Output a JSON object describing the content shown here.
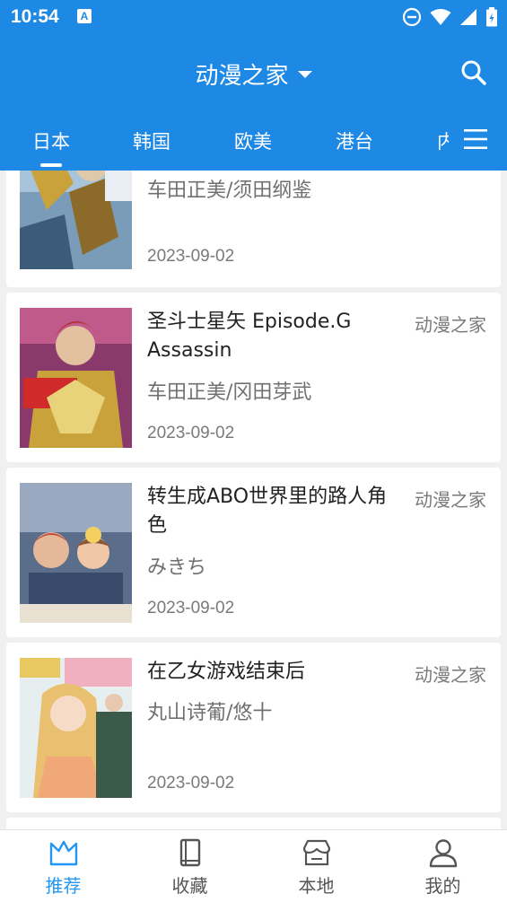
{
  "status_bar": {
    "time": "10:54",
    "notif_letter": "A"
  },
  "app_bar": {
    "title": "动漫之家"
  },
  "tabs": [
    "日本",
    "韩国",
    "欧美",
    "港台",
    "内地"
  ],
  "list": [
    {
      "title": "",
      "author": "车田正美/须田纲鉴",
      "date": "2023-09-02",
      "source": ""
    },
    {
      "title": "圣斗士星矢 Episode.G Assassin",
      "author": "车田正美/冈田芽武",
      "date": "2023-09-02",
      "source": "动漫之家"
    },
    {
      "title": "转生成ABO世界里的路人角色",
      "author": "みきち",
      "date": "2023-09-02",
      "source": "动漫之家"
    },
    {
      "title": "在乙女游戏结束后",
      "author": "丸山诗葡/悠十",
      "date": "2023-09-02",
      "source": "动漫之家"
    }
  ],
  "covers": [
    "cover-art-1",
    "cover-art-2",
    "cover-art-3",
    "cover-art-4"
  ],
  "bottom_nav": [
    {
      "label": "推荐",
      "icon": "crown-icon"
    },
    {
      "label": "收藏",
      "icon": "book-icon"
    },
    {
      "label": "本地",
      "icon": "store-icon"
    },
    {
      "label": "我的",
      "icon": "person-icon"
    }
  ],
  "colors": {
    "primary": "#1e88e5",
    "accent": "#2196f3"
  }
}
